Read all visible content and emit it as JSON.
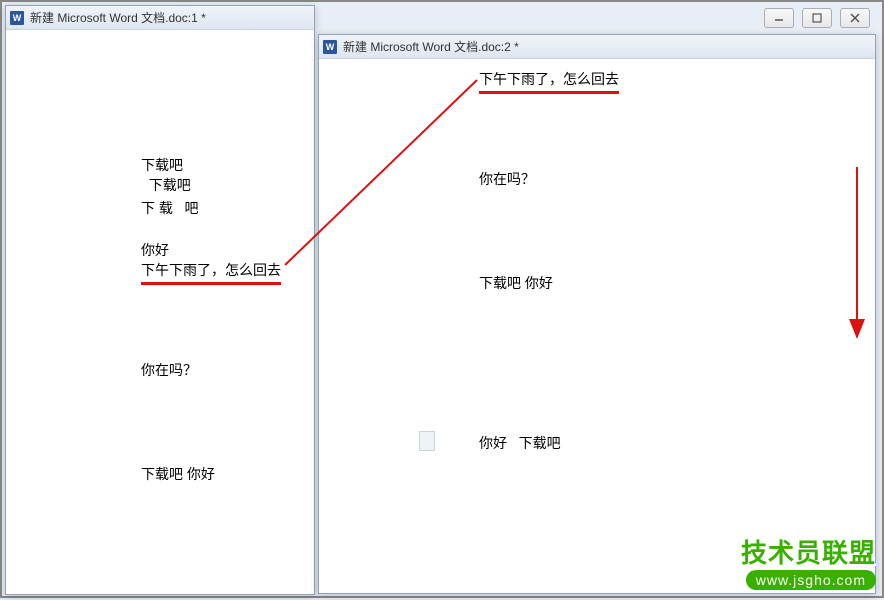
{
  "window1": {
    "title": "新建 Microsoft Word 文档.doc:1 *",
    "lines": {
      "l1": "下载吧",
      "l2": "  下载吧",
      "l3": "下 载   吧",
      "l4": "你好",
      "l5": "下午下雨了，怎么回去",
      "l6": "你在吗？",
      "l7": "下载吧 你好"
    }
  },
  "window2": {
    "title": "新建 Microsoft Word 文档.doc:2 *",
    "lines": {
      "l1": "下午下雨了，怎么回去",
      "l2": "你在吗？",
      "l3": "下载吧 你好",
      "l4": "你好   下载吧"
    }
  },
  "winControls": {
    "minimize": "minimize",
    "maximize": "maximize",
    "close": "close"
  },
  "watermark": {
    "title": "技术员联盟",
    "url": "www.jsgho.com"
  }
}
